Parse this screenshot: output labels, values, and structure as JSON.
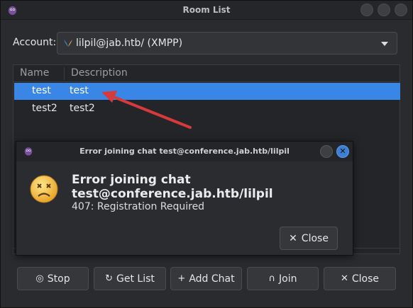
{
  "window": {
    "title": "Room List"
  },
  "account": {
    "label": "Account:",
    "value": "lilpil@jab.htb/ (XMPP)"
  },
  "list": {
    "columns": [
      "Name",
      "Description"
    ],
    "rows": [
      {
        "name": "test",
        "description": "test",
        "selected": true
      },
      {
        "name": "test2",
        "description": "test2",
        "selected": false
      }
    ]
  },
  "buttons": {
    "stop": "Stop",
    "get_list": "Get List",
    "add_chat": "Add Chat",
    "join": "Join",
    "close": "Close"
  },
  "dialog": {
    "title": "Error joining chat test@conference.jab.htb/lilpil",
    "heading": "Error joining chat test@conference.jab.htb/lilpil",
    "message": "407: Registration Required",
    "close_label": "Close"
  },
  "colors": {
    "accent": "#3a86e6",
    "arrow": "#d63a3a",
    "background": "#2a2b2f"
  }
}
